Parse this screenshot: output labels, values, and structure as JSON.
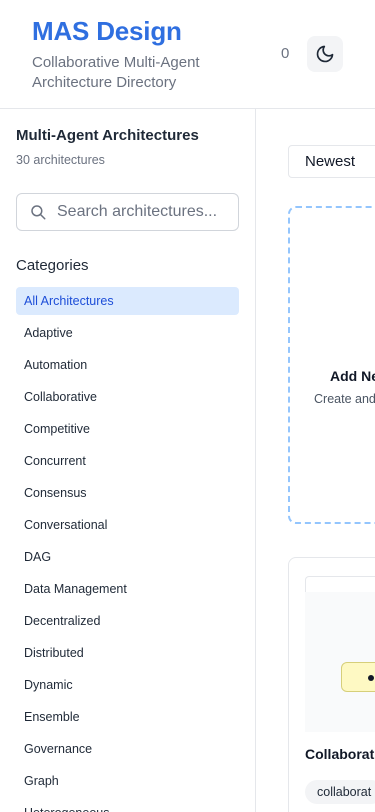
{
  "header": {
    "brand_title": "MAS Design",
    "brand_subtitle": "Collaborative Multi-Agent Architecture Directory",
    "counter": "0",
    "theme_toggle_icon": "moon-icon"
  },
  "sidebar": {
    "title": "Multi-Agent Architectures",
    "count": "30 architectures",
    "search_placeholder": "Search architectures...",
    "categories_heading": "Categories",
    "categories": [
      "All Architectures",
      "Adaptive",
      "Automation",
      "Collaborative",
      "Competitive",
      "Concurrent",
      "Consensus",
      "Conversational",
      "DAG",
      "Data Management",
      "Decentralized",
      "Distributed",
      "Dynamic",
      "Ensemble",
      "Governance",
      "Graph",
      "Heterogeneous"
    ],
    "active_category": "All Architectures"
  },
  "main": {
    "sort_value": "Newest",
    "add_card": {
      "title": "Add Ne",
      "description": "Create and agent arc"
    },
    "cards": [
      {
        "title": "Collaborat",
        "tag": "collaborat"
      }
    ]
  },
  "colors": {
    "brand": "#2f6fe0",
    "active_bg": "#dbeafe",
    "active_text": "#1d4ed8",
    "dashed_border": "#93c5fd",
    "node_fill": "#fef9c3"
  }
}
